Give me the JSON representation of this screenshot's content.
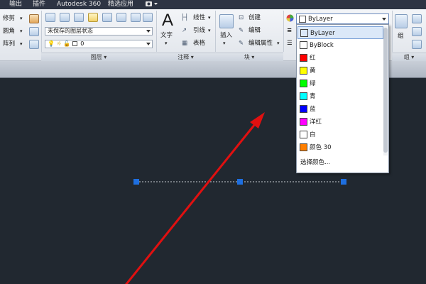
{
  "menubar": {
    "items": [
      "输出",
      "插件",
      "Autodesk 360",
      "精选应用"
    ],
    "extra_icon": "camera-icon"
  },
  "ribbon": {
    "modify": {
      "trim": "修剪",
      "fillet": "圆角",
      "array": "阵列"
    },
    "layers": {
      "state_dropdown": "未保存的图层状态",
      "current_layer": "0",
      "panel_title": "图层"
    },
    "annotation": {
      "text": "文字",
      "linear": "线性",
      "leader": "引线",
      "table": "表格",
      "panel_title": "注释"
    },
    "block": {
      "insert": "插入",
      "create": "创建",
      "edit": "编辑",
      "edit_attributes": "编辑属性",
      "panel_title": "块"
    },
    "groups": {
      "group": "组",
      "panel_title": "组"
    }
  },
  "color_picker": {
    "selected": "ByLayer",
    "items": [
      {
        "label": "ByLayer",
        "color": "#ffffff"
      },
      {
        "label": "ByBlock",
        "color": "#ffffff"
      },
      {
        "label": "红",
        "color": "#ff0000"
      },
      {
        "label": "黄",
        "color": "#ffff00"
      },
      {
        "label": "绿",
        "color": "#00ff00"
      },
      {
        "label": "青",
        "color": "#00ffff"
      },
      {
        "label": "蓝",
        "color": "#0000ff"
      },
      {
        "label": "洋红",
        "color": "#ff00ff"
      },
      {
        "label": "白",
        "color": "#ffffff"
      },
      {
        "label": "颜色 30",
        "color": "#ff7f00"
      }
    ],
    "more": "选择颜色..."
  },
  "colors": {
    "canvas_bg": "#212830",
    "grip": "#1e6fe0",
    "arrow": "#e01010"
  }
}
